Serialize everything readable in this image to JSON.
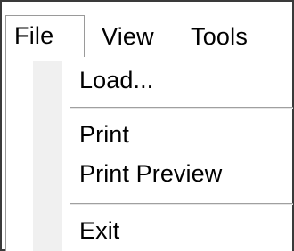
{
  "menubar": {
    "items": [
      {
        "label": "File"
      },
      {
        "label": "View"
      },
      {
        "label": "Tools"
      }
    ]
  },
  "dropdown": {
    "items": [
      {
        "label": "Load..."
      },
      {
        "label": "Print"
      },
      {
        "label": "Print Preview"
      },
      {
        "label": "Exit"
      }
    ]
  }
}
